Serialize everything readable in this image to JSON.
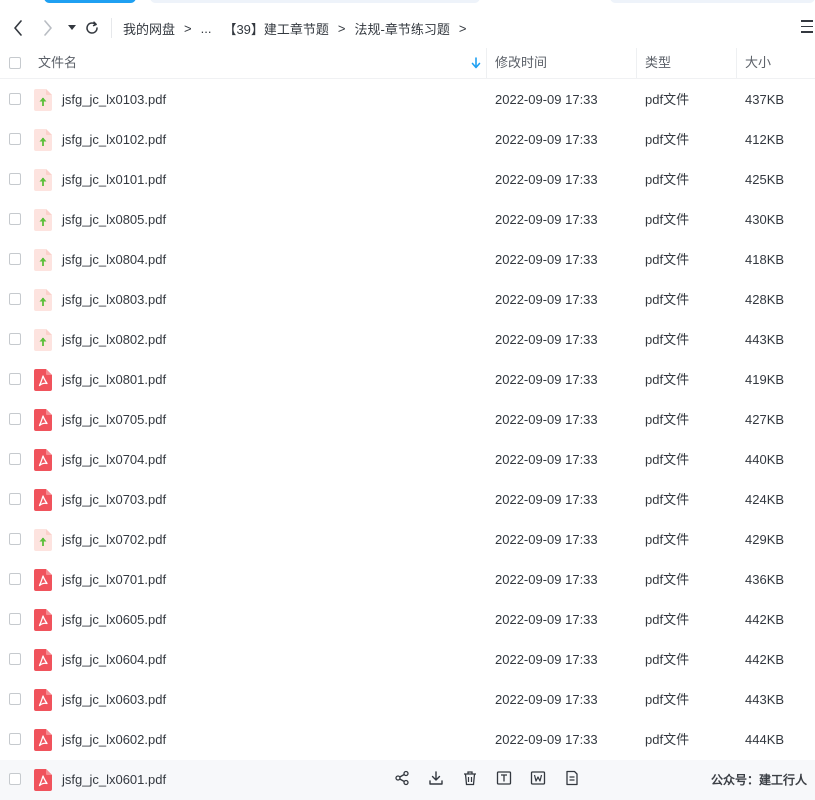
{
  "nav": {
    "breadcrumbs": [
      "我的网盘",
      "...",
      "【39】建工章节题",
      "法规-章节练习题"
    ],
    "separator": ">"
  },
  "table": {
    "headers": {
      "name": "文件名",
      "modified": "修改时间",
      "type": "类型",
      "size": "大小"
    },
    "sort": {
      "column": "name",
      "direction": "down"
    },
    "rows": [
      {
        "name": "jsfg_jc_lx0103.pdf",
        "modified": "2022-09-09 17:33",
        "type": "pdf文件",
        "size": "437KB",
        "icon": "upload-pending-icon"
      },
      {
        "name": "jsfg_jc_lx0102.pdf",
        "modified": "2022-09-09 17:33",
        "type": "pdf文件",
        "size": "412KB",
        "icon": "upload-pending-icon"
      },
      {
        "name": "jsfg_jc_lx0101.pdf",
        "modified": "2022-09-09 17:33",
        "type": "pdf文件",
        "size": "425KB",
        "icon": "upload-pending-icon"
      },
      {
        "name": "jsfg_jc_lx0805.pdf",
        "modified": "2022-09-09 17:33",
        "type": "pdf文件",
        "size": "430KB",
        "icon": "upload-pending-icon"
      },
      {
        "name": "jsfg_jc_lx0804.pdf",
        "modified": "2022-09-09 17:33",
        "type": "pdf文件",
        "size": "418KB",
        "icon": "upload-pending-icon"
      },
      {
        "name": "jsfg_jc_lx0803.pdf",
        "modified": "2022-09-09 17:33",
        "type": "pdf文件",
        "size": "428KB",
        "icon": "upload-pending-icon"
      },
      {
        "name": "jsfg_jc_lx0802.pdf",
        "modified": "2022-09-09 17:33",
        "type": "pdf文件",
        "size": "443KB",
        "icon": "upload-pending-icon"
      },
      {
        "name": "jsfg_jc_lx0801.pdf",
        "modified": "2022-09-09 17:33",
        "type": "pdf文件",
        "size": "419KB",
        "icon": "pdf-icon"
      },
      {
        "name": "jsfg_jc_lx0705.pdf",
        "modified": "2022-09-09 17:33",
        "type": "pdf文件",
        "size": "427KB",
        "icon": "pdf-icon"
      },
      {
        "name": "jsfg_jc_lx0704.pdf",
        "modified": "2022-09-09 17:33",
        "type": "pdf文件",
        "size": "440KB",
        "icon": "pdf-icon"
      },
      {
        "name": "jsfg_jc_lx0703.pdf",
        "modified": "2022-09-09 17:33",
        "type": "pdf文件",
        "size": "424KB",
        "icon": "pdf-icon"
      },
      {
        "name": "jsfg_jc_lx0702.pdf",
        "modified": "2022-09-09 17:33",
        "type": "pdf文件",
        "size": "429KB",
        "icon": "upload-pending-icon"
      },
      {
        "name": "jsfg_jc_lx0701.pdf",
        "modified": "2022-09-09 17:33",
        "type": "pdf文件",
        "size": "436KB",
        "icon": "pdf-icon"
      },
      {
        "name": "jsfg_jc_lx0605.pdf",
        "modified": "2022-09-09 17:33",
        "type": "pdf文件",
        "size": "442KB",
        "icon": "pdf-icon"
      },
      {
        "name": "jsfg_jc_lx0604.pdf",
        "modified": "2022-09-09 17:33",
        "type": "pdf文件",
        "size": "442KB",
        "icon": "pdf-icon"
      },
      {
        "name": "jsfg_jc_lx0603.pdf",
        "modified": "2022-09-09 17:33",
        "type": "pdf文件",
        "size": "443KB",
        "icon": "pdf-icon"
      },
      {
        "name": "jsfg_jc_lx0602.pdf",
        "modified": "2022-09-09 17:33",
        "type": "pdf文件",
        "size": "444KB",
        "icon": "pdf-icon"
      }
    ],
    "hover_row": {
      "name": "jsfg_jc_lx0601.pdf",
      "icon": "pdf-icon",
      "actions": [
        "share-icon",
        "download-icon",
        "delete-icon",
        "text-extract-icon",
        "word-convert-icon",
        "more-file-icon"
      ]
    }
  },
  "watermark": "公众号：建工行人",
  "colors": {
    "accent": "#1fa0f2",
    "pdf_red": "#f0535c",
    "pending_bg": "#fde3df",
    "pending_arrow": "#5bbf3a",
    "text": "#33383f",
    "muted": "#5b6068"
  }
}
